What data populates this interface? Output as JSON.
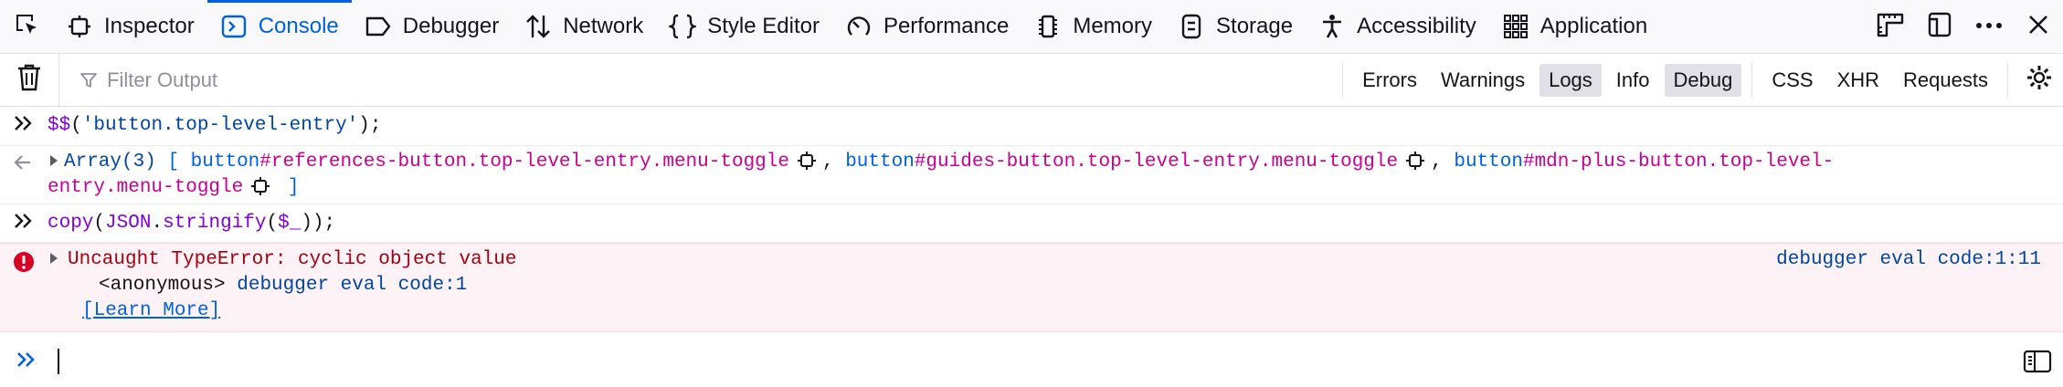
{
  "toolbar": {
    "tabs": [
      {
        "label": "Inspector",
        "icon": "inspector-icon",
        "selected": false
      },
      {
        "label": "Console",
        "icon": "console-icon",
        "selected": true
      },
      {
        "label": "Debugger",
        "icon": "debugger-icon",
        "selected": false
      },
      {
        "label": "Network",
        "icon": "network-icon",
        "selected": false
      },
      {
        "label": "Style Editor",
        "icon": "style-editor-icon",
        "selected": false
      },
      {
        "label": "Performance",
        "icon": "performance-icon",
        "selected": false
      },
      {
        "label": "Memory",
        "icon": "memory-icon",
        "selected": false
      },
      {
        "label": "Storage",
        "icon": "storage-icon",
        "selected": false
      },
      {
        "label": "Accessibility",
        "icon": "accessibility-icon",
        "selected": false
      },
      {
        "label": "Application",
        "icon": "application-icon",
        "selected": false
      }
    ],
    "accent": "#0061e0"
  },
  "filterbar": {
    "placeholder": "Filter Output",
    "levels": [
      {
        "label": "Errors",
        "on": false
      },
      {
        "label": "Warnings",
        "on": false
      },
      {
        "label": "Logs",
        "on": true
      },
      {
        "label": "Info",
        "on": false
      },
      {
        "label": "Debug",
        "on": true
      }
    ],
    "types": [
      "CSS",
      "XHR",
      "Requests"
    ]
  },
  "console": {
    "cmd1": {
      "dollar": "$$",
      "open": "(",
      "str": "'button.top-level-entry'",
      "close": ");"
    },
    "result": {
      "array_label": "Array(3)",
      "open_bracket": "[",
      "close_bracket": "]",
      "comma": ",",
      "items": [
        {
          "tag": "button",
          "selector": "#references-button.top-level-entry.menu-toggle"
        },
        {
          "tag": "button",
          "selector": "#guides-button.top-level-entry.menu-toggle"
        },
        {
          "tag": "button",
          "selector_line1": "#mdn-plus-button.top-level-",
          "selector_line2": "entry.menu-toggle"
        }
      ]
    },
    "cmd2": {
      "fn": "copy",
      "p1": "(",
      "obj": "JSON",
      "dot": ".",
      "method": "stringify",
      "p2": "(",
      "arg": "$_",
      "close": "));"
    },
    "error": {
      "message": "Uncaught TypeError: cyclic object value",
      "frame_name": "<anonymous>",
      "frame_loc": "debugger eval code:1",
      "learn_more": "[Learn More]",
      "location": "debugger eval code:1:11",
      "color": "#a4000f"
    }
  }
}
